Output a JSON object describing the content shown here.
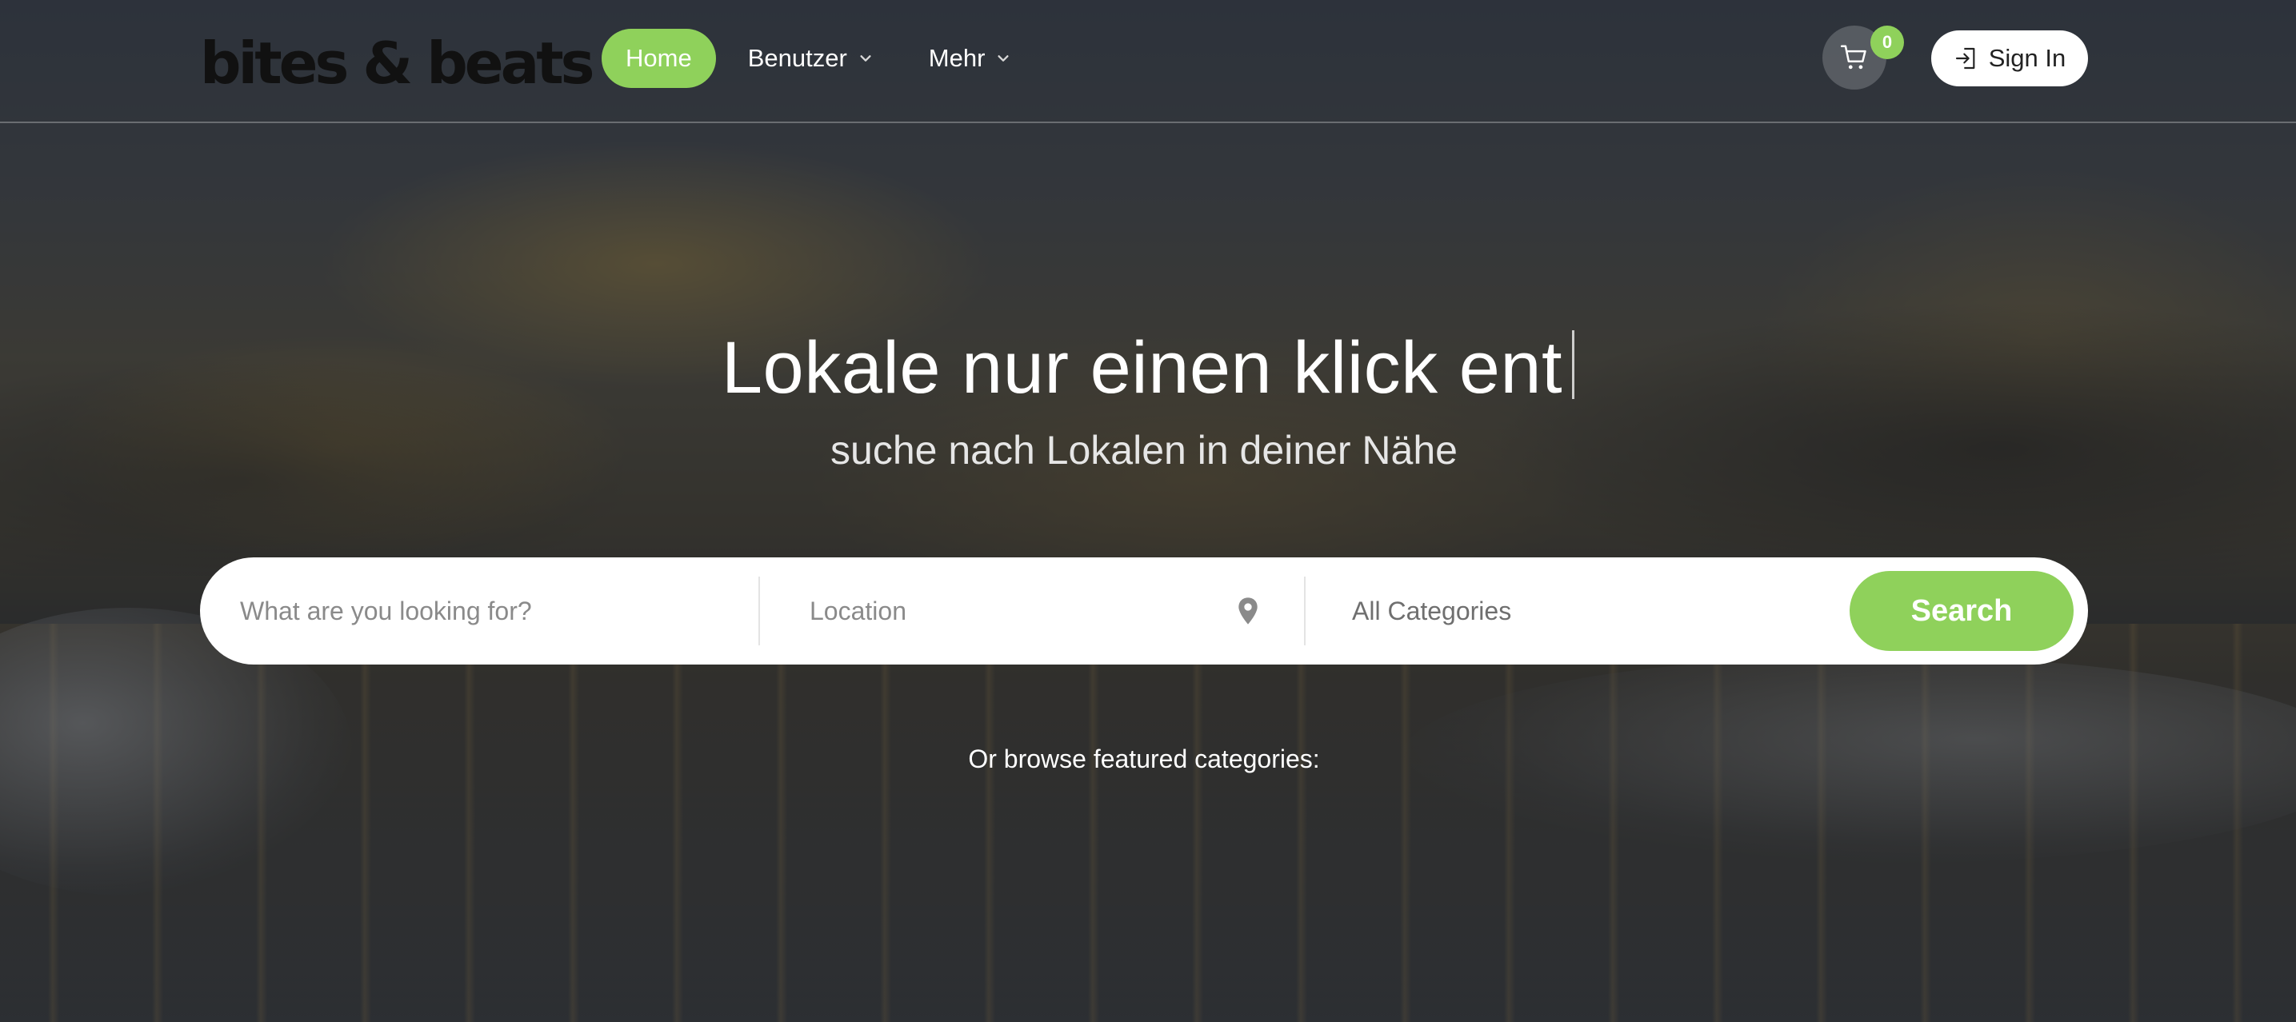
{
  "brand": {
    "logo_text": "bites & beats",
    "accent_color": "#8fd15b"
  },
  "nav": {
    "items": [
      {
        "label": "Home",
        "active": true,
        "has_dropdown": false
      },
      {
        "label": "Benutzer",
        "active": false,
        "has_dropdown": true
      },
      {
        "label": "Mehr",
        "active": false,
        "has_dropdown": true
      }
    ]
  },
  "header": {
    "cart": {
      "icon": "shopping-cart-icon",
      "count": "0"
    },
    "signin": {
      "icon": "sign-in-icon",
      "label": "Sign In"
    }
  },
  "hero": {
    "title": "Lokale nur einen klick ent",
    "subtitle": "suche nach Lokalen in deiner Nähe"
  },
  "search": {
    "what_placeholder": "What are you looking for?",
    "location_placeholder": "Location",
    "location_icon": "map-pin-icon",
    "category_selected": "All Categories",
    "button_label": "Search"
  },
  "browse": {
    "label": "Or browse featured categories:"
  }
}
